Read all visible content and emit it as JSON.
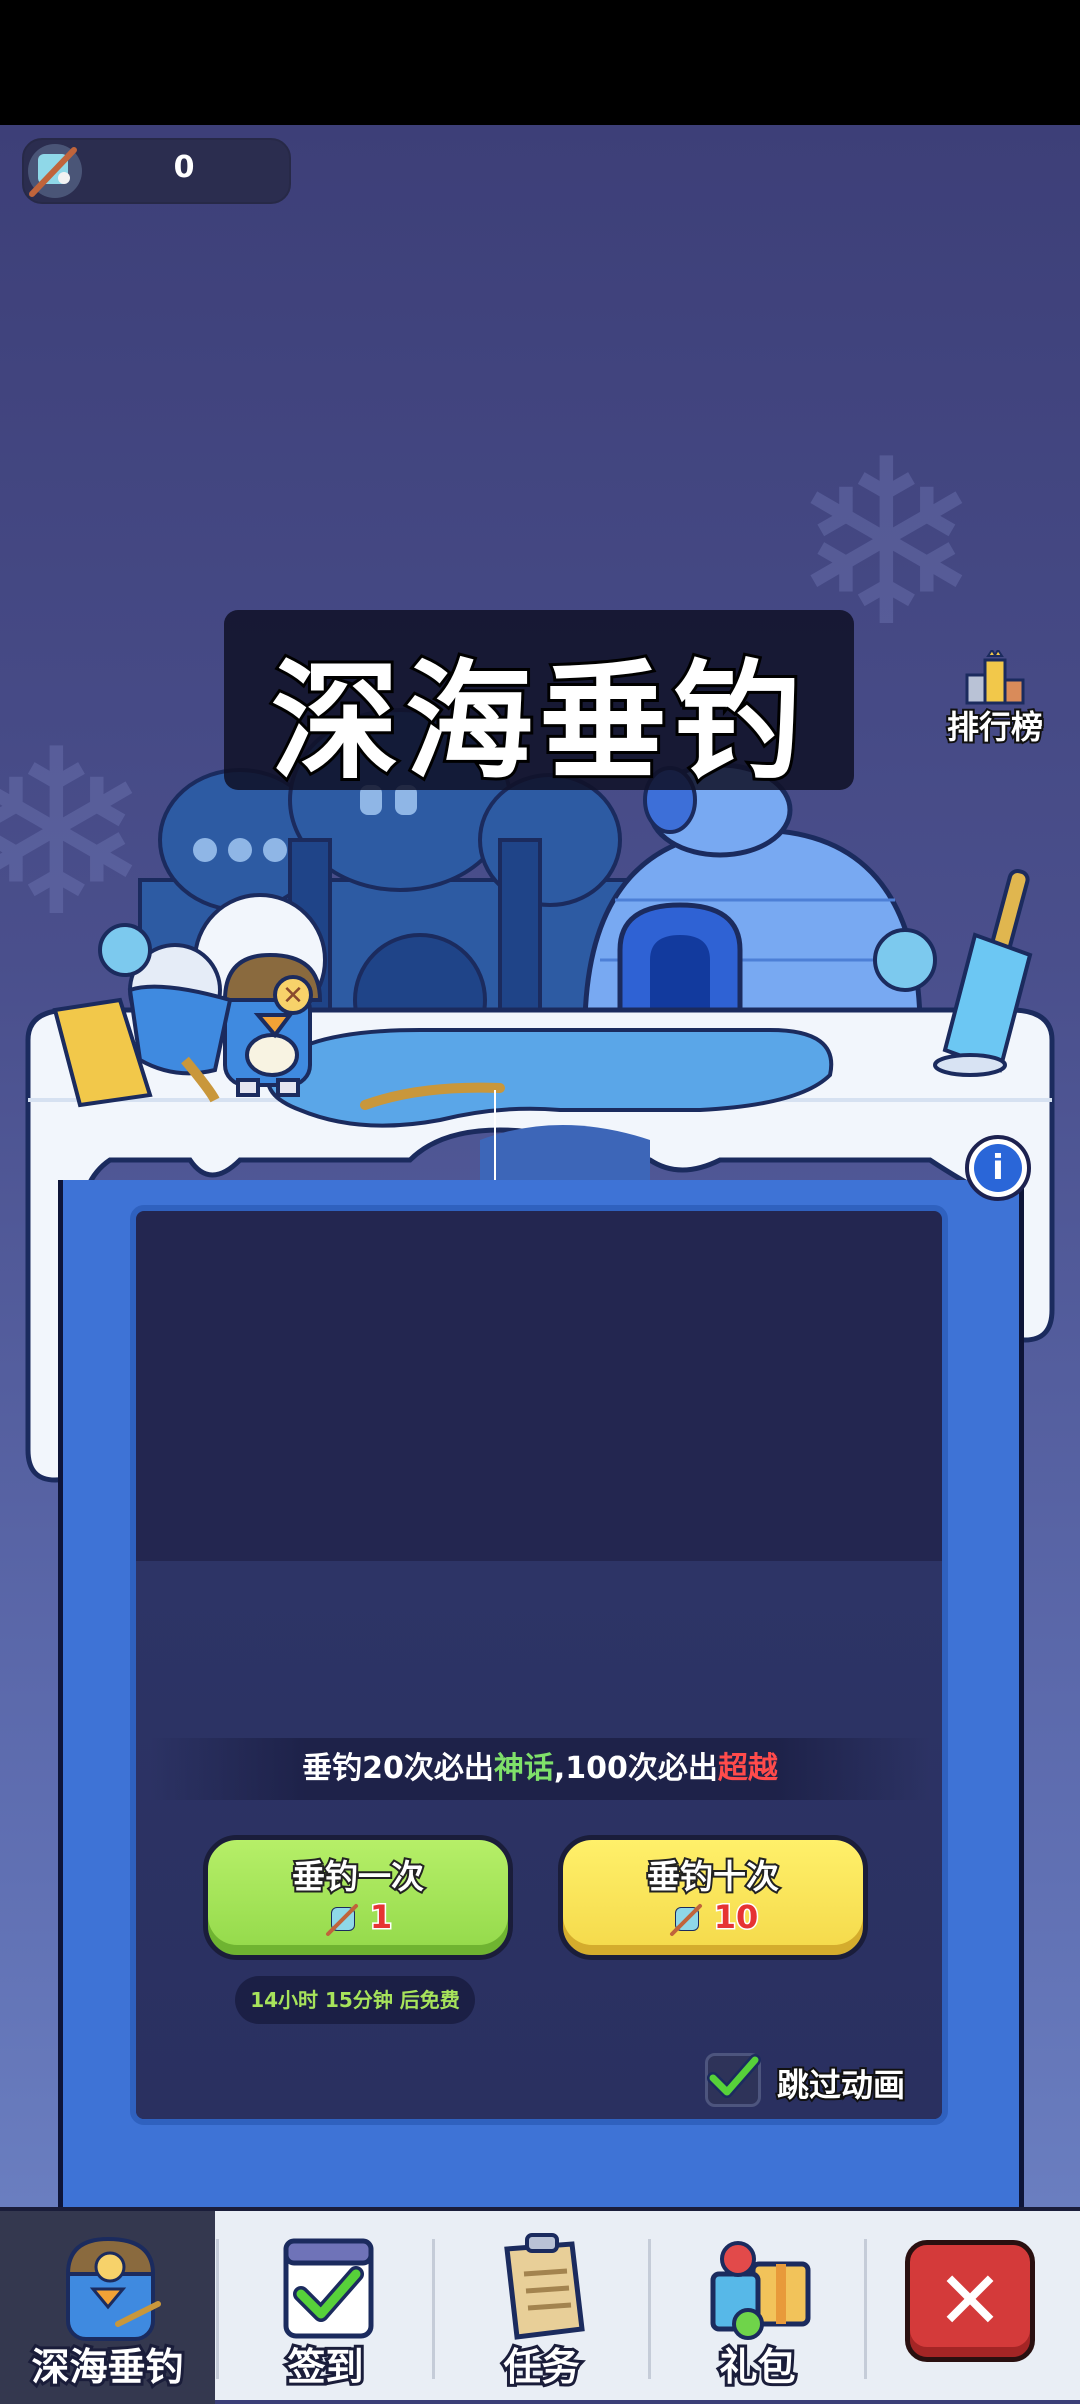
{
  "counter": {
    "value": "0",
    "icon": "fishing-rod-icon"
  },
  "title": "深海垂钓",
  "ranking": {
    "label": "排行榜",
    "icon": "trophy-podium-icon"
  },
  "info_button": {
    "icon": "info-icon",
    "glyph": "i"
  },
  "guarantee": {
    "part1": "垂钓20次必出",
    "myth": "神话",
    "part2": ",100次必出",
    "transcend": "超越",
    "colors": {
      "myth": "#7fe06a",
      "transcend": "#ff4b4b"
    }
  },
  "buttons": {
    "fish_once": {
      "label": "垂钓一次",
      "cost": "1",
      "color": "#9be04f"
    },
    "fish_ten": {
      "label": "垂钓十次",
      "cost": "10",
      "color": "#f7df52"
    }
  },
  "free_timer": "14小时 15分钟 后免费",
  "skip_animation": {
    "label": "跳过动画",
    "checked": true
  },
  "nav": [
    {
      "label": "深海垂钓",
      "icon": "penguin-fishing-icon",
      "active": true
    },
    {
      "label": "签到",
      "icon": "calendar-check-icon",
      "active": false
    },
    {
      "label": "任务",
      "icon": "clipboard-scroll-icon",
      "active": false
    },
    {
      "label": "礼包",
      "icon": "gift-box-icon",
      "active": false
    }
  ],
  "close_button": {
    "icon": "close-icon",
    "glyph": "✕"
  }
}
